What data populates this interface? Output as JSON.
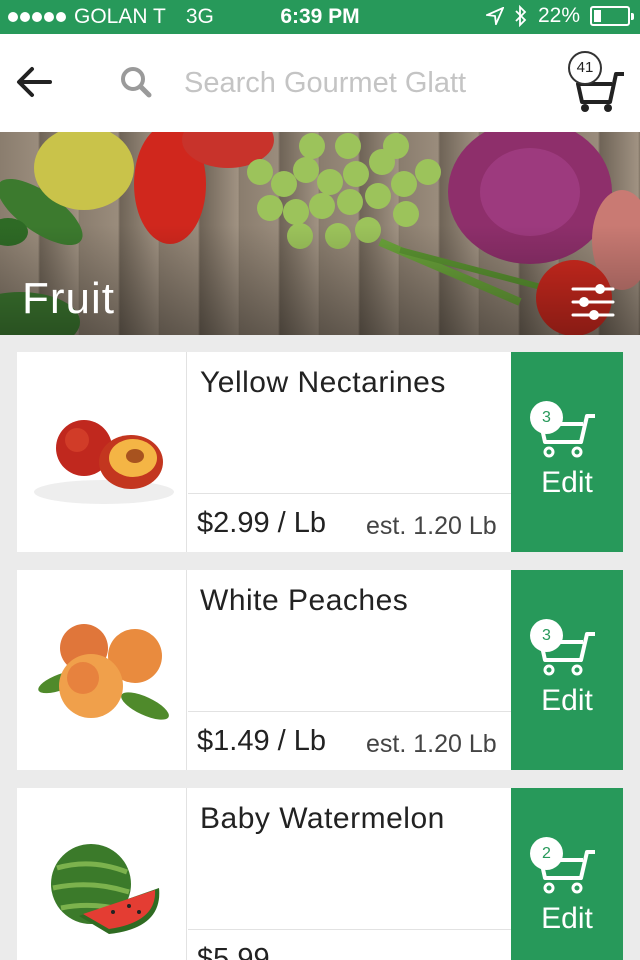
{
  "status_bar": {
    "carrier": "GOLAN T",
    "network": "3G",
    "time": "6:39 PM",
    "battery": "22%",
    "battery_level": 0.22
  },
  "header": {
    "search_placeholder": "Search Gourmet Glatt",
    "cart_count": "41"
  },
  "banner": {
    "title": "Fruit"
  },
  "products": [
    {
      "name": "Yellow Nectarines",
      "price": "$2.99 / Lb",
      "estimate": "est. 1.20 Lb",
      "cart_qty": "3",
      "edit_label": "Edit"
    },
    {
      "name": "White Peaches",
      "price": "$1.49 / Lb",
      "estimate": "est. 1.20 Lb",
      "cart_qty": "3",
      "edit_label": "Edit"
    },
    {
      "name": "Baby Watermelon",
      "price": "$5.99",
      "estimate": "",
      "cart_qty": "2",
      "edit_label": "Edit"
    }
  ],
  "colors": {
    "accent": "#27995a"
  }
}
